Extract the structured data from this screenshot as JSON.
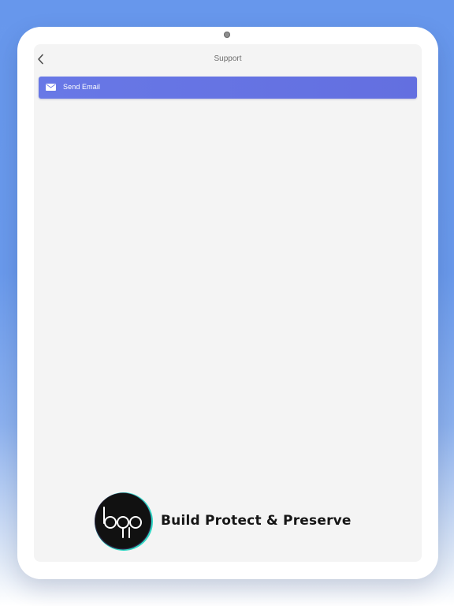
{
  "header": {
    "title": "Support",
    "back_icon": "chevron-left-icon"
  },
  "actions": {
    "send_email_label": "Send Email",
    "send_email_icon": "mail-icon"
  },
  "brand": {
    "logo_text": "bpp",
    "name": "Build Protect & Preserve"
  },
  "colors": {
    "button": "#6673e4",
    "background": "#f4f4f4",
    "brand_accent": "#2fd6c3"
  }
}
